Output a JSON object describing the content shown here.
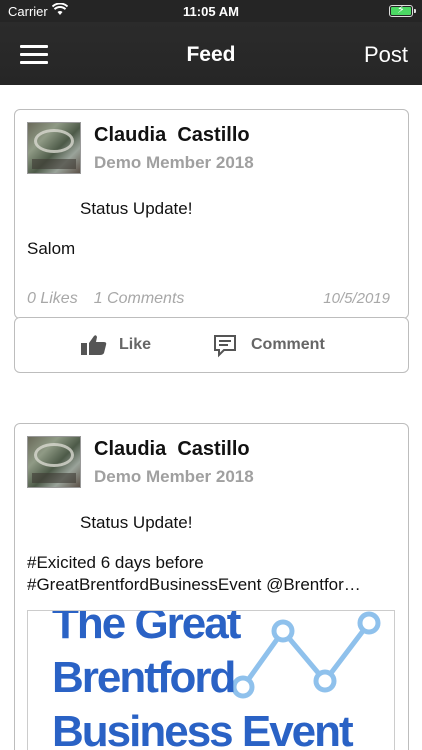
{
  "status_bar": {
    "carrier": "Carrier",
    "time": "11:05 AM"
  },
  "nav": {
    "title": "Feed",
    "post_label": "Post"
  },
  "posts": [
    {
      "author": "Claudia  Castillo",
      "member_label": "Demo Member 2018",
      "type_label": "Status Update!",
      "body": "Salom",
      "likes": "0 Likes",
      "comments": "1 Comments",
      "date": "10/5/2019"
    },
    {
      "author": "Claudia  Castillo",
      "member_label": "Demo Member 2018",
      "type_label": "Status Update!",
      "body_line1": "#Exicited 6 days before",
      "body_line2": "#GreatBrentfordBusinessEvent @Brentfor…",
      "image_lines": [
        "The Great",
        "Brentford",
        "Business Event"
      ]
    }
  ],
  "actions": {
    "like_label": "Like",
    "comment_label": "Comment"
  },
  "colors": {
    "bar": "#262626",
    "accent_blue": "#2a62c5",
    "muted": "#a8a8a8"
  }
}
